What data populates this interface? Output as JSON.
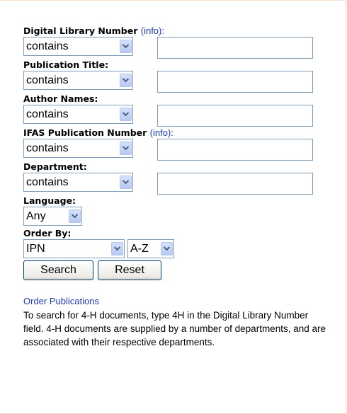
{
  "fields": {
    "dln": {
      "label": "Digital Library Number",
      "info": "(info):",
      "operator": "contains",
      "value": ""
    },
    "title": {
      "label": "Publication Title:",
      "operator": "contains",
      "value": ""
    },
    "author": {
      "label": "Author Names:",
      "operator": "contains",
      "value": ""
    },
    "ipn": {
      "label": "IFAS Publication Number",
      "info": "(info):",
      "operator": "contains",
      "value": ""
    },
    "department": {
      "label": "Department:",
      "operator": "contains",
      "value": ""
    }
  },
  "language": {
    "label": "Language:",
    "selected": "Any"
  },
  "order": {
    "label": "Order By:",
    "field": "IPN",
    "direction": "A-Z"
  },
  "buttons": {
    "search": "Search",
    "reset": "Reset"
  },
  "footer": {
    "link": "Order Publications",
    "note": "To search for 4-H documents, type 4H in the Digital Library Number field. 4-H documents are supplied by a number of departments, and are associated with their respective departments."
  },
  "colors": {
    "link": "#1a38b8",
    "border": "#7f9db9",
    "panel_edge": "#f2d5bf"
  },
  "icons": {
    "dropdown": "chevron-down-icon"
  }
}
